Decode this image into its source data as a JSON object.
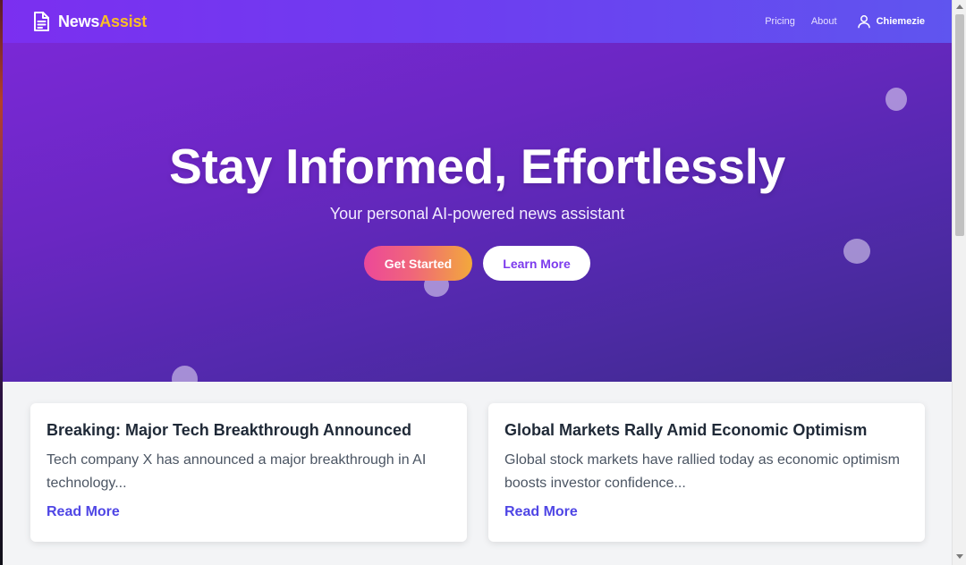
{
  "brand": {
    "name": "News",
    "accent": "Assist",
    "icon": "document-icon"
  },
  "nav": {
    "links": [
      "Pricing",
      "About"
    ],
    "user": {
      "name": "Chiemezie",
      "icon": "user-icon"
    }
  },
  "hero": {
    "title": "Stay Informed, Effortlessly",
    "subtitle": "Your personal AI-powered news assistant",
    "primary_button": "Get Started",
    "secondary_button": "Learn More"
  },
  "cards": [
    {
      "title": "Breaking: Major Tech Breakthrough Announced",
      "excerpt": "Tech company X has announced a major breakthrough in AI technology...",
      "link": "Read More"
    },
    {
      "title": "Global Markets Rally Amid Economic Optimism",
      "excerpt": "Global stock markets have rallied today as economic optimism boosts investor confidence...",
      "link": "Read More"
    }
  ],
  "colors": {
    "brand_accent": "#fbbf24",
    "link": "#4f46e5",
    "secondary_button_text": "#7c3aed"
  }
}
